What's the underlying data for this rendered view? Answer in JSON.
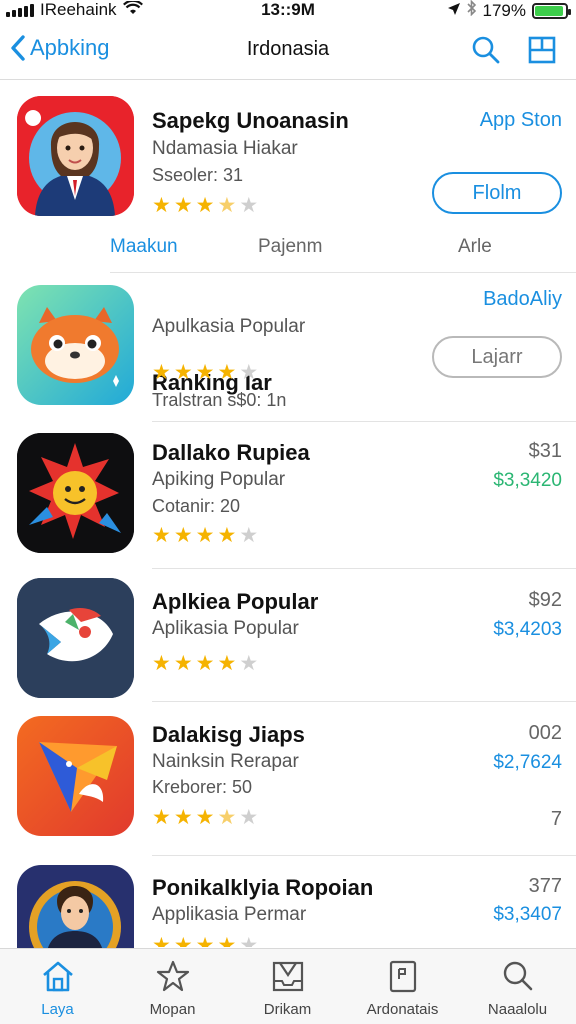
{
  "status_bar": {
    "carrier": "IReehaink",
    "time": "13::9M",
    "battery": "179%",
    "battery_level": 0.92
  },
  "nav": {
    "back_label": "Apbking",
    "title": "Irdonasia"
  },
  "section_tabs": [
    "Maakun",
    "Pajenm",
    "Arle"
  ],
  "apps": [
    {
      "name": "Sapekg Unoanasin",
      "subtitle": "Ndamasia Hiakar",
      "meta": "Sseoler: 31",
      "rating": 3.5,
      "right_top": "App Ston",
      "button": "Flolm"
    },
    {
      "name": "Ranking Iar",
      "subtitle": "Apulkasia Popular",
      "meta": "Tralstran s$0: 1n",
      "rating": 4,
      "right_top": "BadoAliy",
      "button": "Lajarr"
    },
    {
      "name": "Dallako Rupiea",
      "subtitle": "Apiking Popular",
      "meta": "Cotanir: 20",
      "rating": 4,
      "right_top": "$31",
      "price": "$3,3420"
    },
    {
      "name": "Aplkiea Popular",
      "subtitle": "Aplikasia Popular",
      "rating": 4,
      "right_top": "$92",
      "price": "$3,4203"
    },
    {
      "name": "Dalakisg Jiaps",
      "subtitle": "Nainksin Rerapar",
      "meta": "Kreborer: 50",
      "rating": 3.5,
      "right_top": "002",
      "price": "$2,7624",
      "right_bottom": "7"
    },
    {
      "name": "Ponikalklyia Ropoian",
      "subtitle": "Applikasia Permar",
      "rating": 4,
      "right_top": "377",
      "price": "$3,3407"
    }
  ],
  "tab_bar": [
    {
      "label": "Laya",
      "icon": "home-icon"
    },
    {
      "label": "Mopan",
      "icon": "star-icon"
    },
    {
      "label": "Drikam",
      "icon": "tray-icon"
    },
    {
      "label": "Ardonatais",
      "icon": "document-icon"
    },
    {
      "label": "Naaalolu",
      "icon": "search-icon"
    }
  ],
  "colors": {
    "accent": "#1a8fe0",
    "price_green": "#2bb673",
    "star": "#f5b301"
  }
}
